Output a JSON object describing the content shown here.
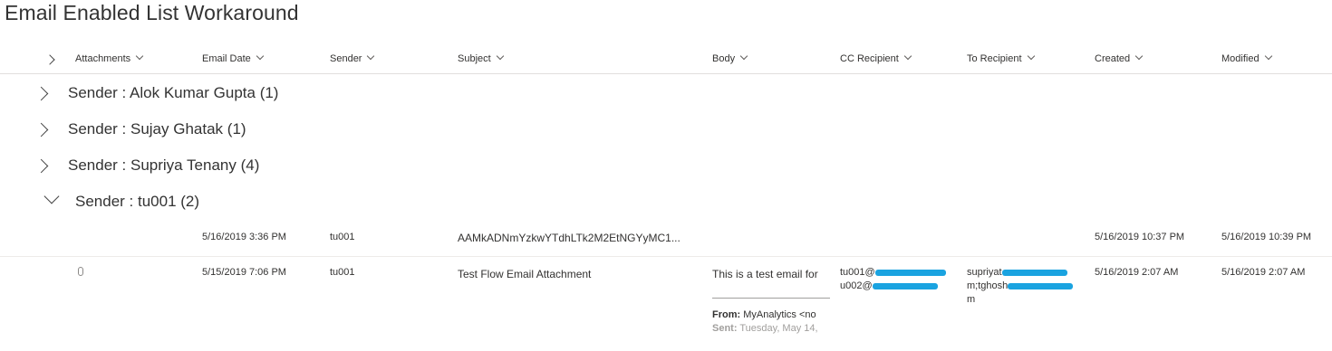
{
  "page_title": "Email Enabled List Workaround",
  "columns": [
    "Attachments",
    "Email Date",
    "Sender",
    "Subject",
    "Body",
    "CC Recipient",
    "To Recipient",
    "Created",
    "Modified"
  ],
  "groups": [
    {
      "label": "Sender : Alok Kumar Gupta",
      "count": "(1)",
      "expanded": false
    },
    {
      "label": "Sender : Sujay Ghatak",
      "count": "(1)",
      "expanded": false
    },
    {
      "label": "Sender : Supriya Tenany",
      "count": "(4)",
      "expanded": false
    },
    {
      "label": "Sender : tu001",
      "count": "(2)",
      "expanded": true
    }
  ],
  "rows": [
    {
      "attachment": false,
      "email_date": "5/16/2019 3:36 PM",
      "sender": "tu001",
      "subject": "AAMkADNmYzkwYTdhLTk2M2EtNGYyMC1...",
      "created": "5/16/2019 10:37 PM",
      "modified": "5/16/2019 10:39 PM"
    },
    {
      "attachment": true,
      "email_date": "5/15/2019 7:06 PM",
      "sender": "tu001",
      "subject": "Test Flow Email Attachment",
      "body_line1": "This is a test email for",
      "body_from_label": "From:",
      "body_from_value": "MyAnalytics <no",
      "body_sent_label": "Sent:",
      "body_sent_value": "Tuesday, May 14,",
      "cc_line1": "tu001@",
      "cc_line2": "u002@",
      "to_line1": "supriyat",
      "to_line2": "m;tghosh",
      "to_line3": "m",
      "created": "5/16/2019 2:07 AM",
      "modified": "5/16/2019 2:07 AM"
    }
  ],
  "colors": {
    "redaction": "#1aa3e0",
    "divider": "#e1dfdd"
  },
  "icons": {
    "expand_all": "chevron-right-icon",
    "sort": "chevron-down-icon",
    "attachment": "paperclip-icon"
  }
}
